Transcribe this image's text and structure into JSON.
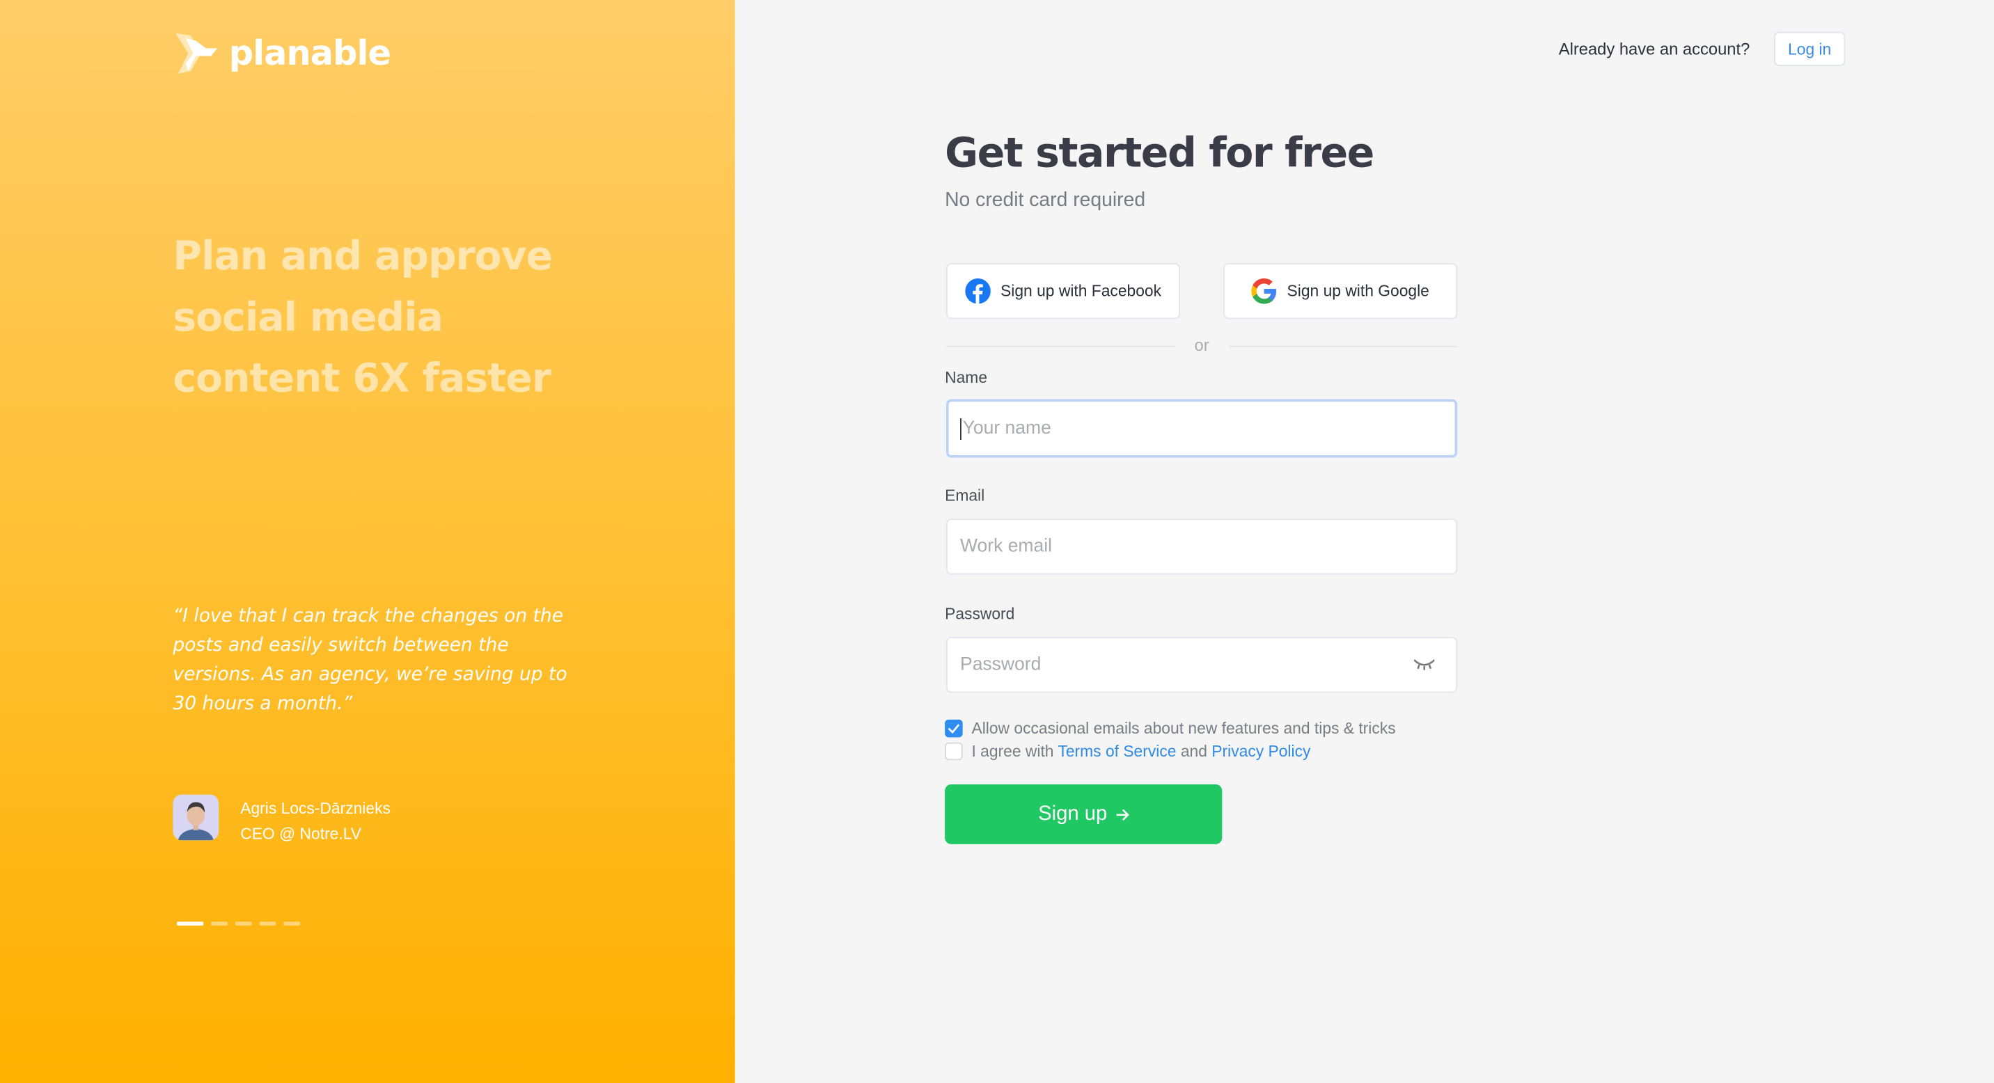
{
  "brand": {
    "name": "planable",
    "panel_colors": [
      "#ffcd68",
      "#ffb000"
    ]
  },
  "promo": {
    "headline": "Plan and approve social media content 6X faster",
    "quote": "“I love that I can track the changes on the posts and easily switch between the versions. As an agency, we’re saving up to 30 hours a month.”",
    "author_name": "Agris Locs-Dārznieks",
    "author_role": "CEO @ Notre.LV",
    "carousel": {
      "slides": 5,
      "active": 1
    }
  },
  "header": {
    "already": "Already have an account?",
    "login": "Log in"
  },
  "form": {
    "title": "Get started for free",
    "subtitle": "No credit card required",
    "facebook": "Sign up with Facebook",
    "google": "Sign up with Google",
    "or": "or",
    "name_label": "Name",
    "name_placeholder": "Your name",
    "email_label": "Email",
    "email_placeholder": "Work email",
    "password_label": "Password",
    "password_placeholder": "Password",
    "newsletter": {
      "label": "Allow occasional emails about new features and tips & tricks",
      "checked": true
    },
    "terms": {
      "prefix": "I agree with",
      "tos": "Terms of Service",
      "and": "and",
      "privacy": "Privacy Policy",
      "checked": false
    },
    "submit": "Sign up",
    "accent": "#1fc863",
    "link_color": "#2f8ae8"
  }
}
